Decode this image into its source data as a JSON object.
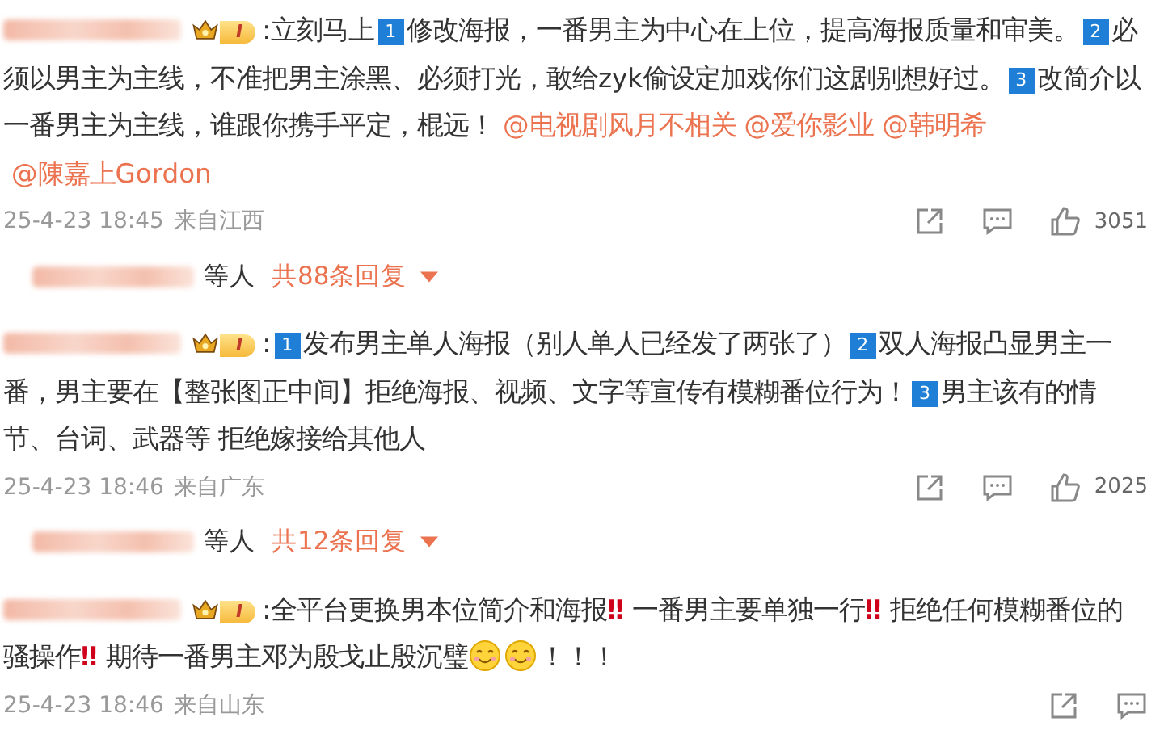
{
  "comments": [
    {
      "badge": "I",
      "content": [
        {
          "kind": "text",
          "text": ":立刻马上"
        },
        {
          "kind": "num",
          "text": "1"
        },
        {
          "kind": "text",
          "text": "修改海报，一番男主为中心在上位，提高海报质量和审美。"
        },
        {
          "kind": "num",
          "text": "2"
        },
        {
          "kind": "text",
          "text": "必须以男主为主线，不准把男主涂黑、必须打光，敢给zyk偷设定加戏你们这剧别想好过。"
        },
        {
          "kind": "num",
          "text": "3"
        },
        {
          "kind": "text",
          "text": "改简介以一番男主为主线，谁跟你携手平定，棍远！"
        },
        {
          "kind": "mention",
          "text": "@电视剧风月不相关"
        },
        {
          "kind": "mention",
          "text": "@爱你影业"
        },
        {
          "kind": "mention",
          "text": "@韩明希"
        },
        {
          "kind": "mention",
          "text": "@陳嘉上Gordon"
        }
      ],
      "time": "25-4-23 18:45",
      "location": "来自江西",
      "likes": "3051",
      "replies": {
        "who": "等人",
        "count": "共88条回复"
      }
    },
    {
      "badge": "I",
      "content": [
        {
          "kind": "text",
          "text": ":"
        },
        {
          "kind": "num",
          "text": "1"
        },
        {
          "kind": "text",
          "text": "发布男主单人海报（别人单人已经发了两张了）"
        },
        {
          "kind": "num",
          "text": "2"
        },
        {
          "kind": "text",
          "text": "双人海报凸显男主一番，男主要在【整张图正中间】拒绝海报、视频、文字等宣传有模糊番位行为！"
        },
        {
          "kind": "num",
          "text": "3"
        },
        {
          "kind": "text",
          "text": "男主该有的情节、台词、武器等 拒绝嫁接给其他人"
        }
      ],
      "time": "25-4-23 18:46",
      "location": "来自广东",
      "likes": "2025",
      "replies": {
        "who": "等人",
        "count": "共12条回复"
      }
    },
    {
      "badge": "I",
      "content": [
        {
          "kind": "text",
          "text": ":全平台更换男本位简介和海报"
        },
        {
          "kind": "alert",
          "text": "‼"
        },
        {
          "kind": "text",
          "text": " 一番男主要单独一行"
        },
        {
          "kind": "alert",
          "text": "‼"
        },
        {
          "kind": "text",
          "text": " 拒绝任何模糊番位的骚操作"
        },
        {
          "kind": "alert",
          "text": "‼"
        },
        {
          "kind": "text",
          "text": " 期待一番男主邓为殷戈止殷沉璧"
        },
        {
          "kind": "smile"
        },
        {
          "kind": "smile"
        },
        {
          "kind": "text",
          "text": "！！！"
        }
      ],
      "time": "25-4-23 18:46",
      "location": "来自山东"
    }
  ]
}
